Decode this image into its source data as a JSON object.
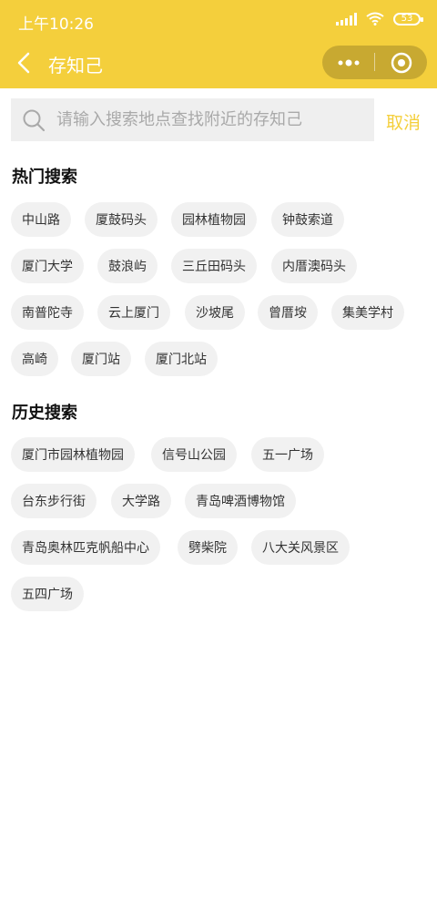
{
  "status_bar": {
    "time": "上午10:26",
    "battery": "53"
  },
  "navbar": {
    "title": "存知己"
  },
  "search": {
    "placeholder": "请输入搜索地点查找附近的存知己",
    "cancel_label": "取消"
  },
  "hot": {
    "title": "热门搜索",
    "tags": [
      "中山路",
      "厦鼓码头",
      "园林植物园",
      "钟鼓索道",
      "厦门大学",
      "鼓浪屿",
      "三丘田码头",
      "内厝澳码头",
      "南普陀寺",
      "云上厦门",
      "沙坡尾",
      "曾厝垵",
      "集美学村",
      "高崎",
      "厦门站",
      "厦门北站"
    ]
  },
  "history": {
    "title": "历史搜索",
    "tags": [
      "厦门市园林植物园",
      "信号山公园",
      "五一广场",
      "台东步行街",
      "大学路",
      "青岛啤酒博物馆",
      "青岛奥林匹克帆船中心",
      "劈柴院",
      "八大关风景区",
      "五四广场"
    ]
  }
}
